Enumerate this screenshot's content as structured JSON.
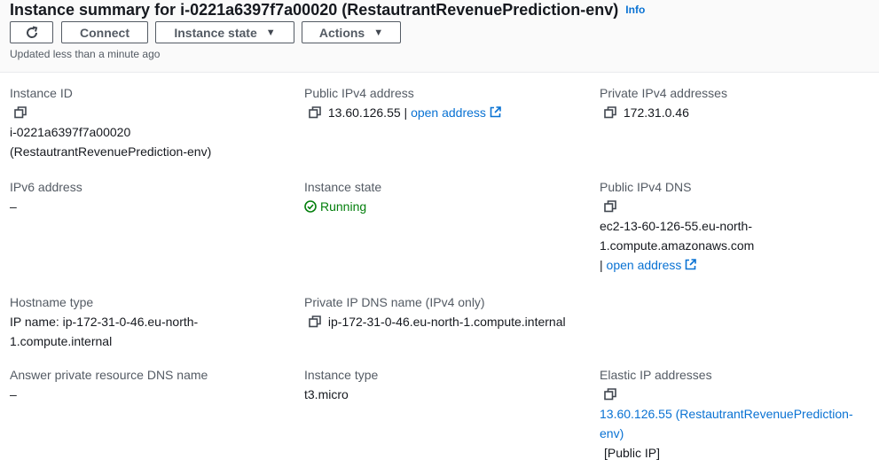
{
  "header": {
    "title": "Instance summary for i-0221a6397f7a00020 (RestautrantRevenuePrediction-env)",
    "info_label": "Info",
    "updated": "Updated less than a minute ago"
  },
  "toolbar": {
    "connect_label": "Connect",
    "instance_state_label": "Instance state",
    "actions_label": "Actions"
  },
  "fields": {
    "instance_id": {
      "label": "Instance ID",
      "value_line1": "i-0221a6397f7a00020",
      "value_line2": "(RestautrantRevenuePrediction-env)"
    },
    "public_ipv4": {
      "label": "Public IPv4 address",
      "value": "13.60.126.55",
      "separator": "|",
      "link": "open address"
    },
    "private_ipv4": {
      "label": "Private IPv4 addresses",
      "value": "172.31.0.46"
    },
    "ipv6": {
      "label": "IPv6 address",
      "value": "–"
    },
    "instance_state": {
      "label": "Instance state",
      "value": "Running"
    },
    "public_dns": {
      "label": "Public IPv4 DNS",
      "value_line1": "ec2-13-60-126-55.eu-north-",
      "value_line2": "1.compute.amazonaws.com",
      "separator": "|",
      "link": "open address"
    },
    "hostname_type": {
      "label": "Hostname type",
      "value_line1": "IP name: ip-172-31-0-46.eu-north-",
      "value_line2": "1.compute.internal"
    },
    "private_dns": {
      "label": "Private IP DNS name (IPv4 only)",
      "value": "ip-172-31-0-46.eu-north-1.compute.internal"
    },
    "answer_dns": {
      "label": "Answer private resource DNS name",
      "value": "–"
    },
    "instance_type": {
      "label": "Instance type",
      "value": "t3.micro"
    },
    "elastic_ip": {
      "label": "Elastic IP addresses",
      "link_line1": "13.60.126.55 (RestautrantRevenuePrediction-",
      "link_line2": "env)",
      "note": "[Public IP]"
    }
  },
  "colors": {
    "link": "#0972d3",
    "success": "#037f0c",
    "label": "#545b64",
    "text": "#16191f"
  }
}
